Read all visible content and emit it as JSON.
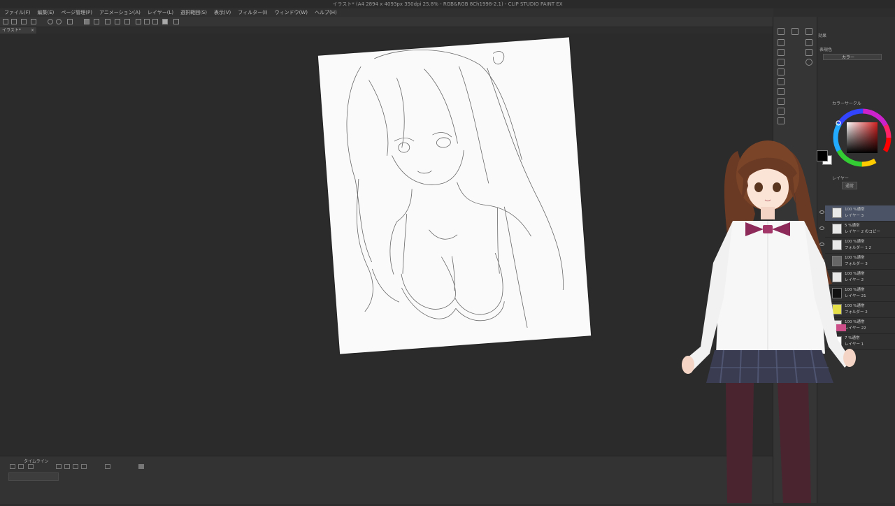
{
  "window": {
    "title": "イラスト* (A4 2894 x 4093px 350dpi 25.8% - RGB&RGB 8Ch1998-2.1) - CLIP STUDIO PAINT EX"
  },
  "menu": [
    "ファイル(F)",
    "編集(E)",
    "ページ管理(P)",
    "アニメーション(A)",
    "レイヤー(L)",
    "選択範囲(S)",
    "表示(V)",
    "フィルター(I)",
    "ウィンドウ(W)",
    "ヘルプ(H)"
  ],
  "document_tab": {
    "label": "イラスト*",
    "close": "×"
  },
  "panels": {
    "effects": {
      "title": "効果",
      "expression_label": "表現色",
      "expression_value": "カラー"
    },
    "color_circle": {
      "title": "カラーサークル"
    },
    "layer": {
      "title": "レイヤー",
      "blend_mode": "通常"
    }
  },
  "layers": [
    {
      "opacity": "100 %通常",
      "name": "レイヤー 3",
      "active": true
    },
    {
      "opacity": "5 %通常",
      "name": "レイヤー 2 のコピー",
      "active": false
    },
    {
      "opacity": "100 %通常",
      "name": "フォルダー 1 2",
      "active": false
    },
    {
      "opacity": "100 %通常",
      "name": "フォルダー 3",
      "active": false
    },
    {
      "opacity": "100 %通常",
      "name": "レイヤー 2",
      "active": false
    },
    {
      "opacity": "100 %通常",
      "name": "レイヤー 21",
      "active": false
    },
    {
      "opacity": "100 %通常",
      "name": "フォルダー 2",
      "active": false
    },
    {
      "opacity": "100 %通常",
      "name": "レイヤー 22",
      "active": false
    },
    {
      "opacity": "7 %通常",
      "name": "レイヤー 1",
      "active": false
    }
  ],
  "timeline": {
    "title": "タイムライン"
  },
  "colors": {
    "main": "#000000",
    "sub": "#ffffff",
    "picked": "#d42020"
  }
}
